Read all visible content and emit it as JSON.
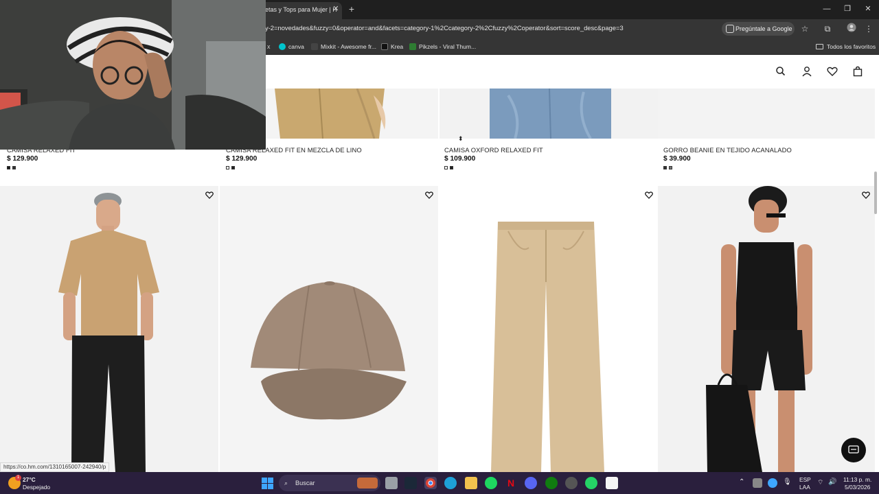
{
  "browser": {
    "tab_title": "etas y Tops para Mujer | H",
    "url": "y-2=novedades&fuzzy=0&operator=and&facets=category-1%2Ccategory-2%2Cfuzzy%2Coperator&sort=score_desc&page=3",
    "ask_google": "Pregúntale a Google",
    "bookmarks": [
      {
        "label": "canva",
        "color": "#00c4cc"
      },
      {
        "label": "Mixkit - Awesome fr...",
        "color": "#444444"
      },
      {
        "label": "Krea",
        "color": "#111111"
      },
      {
        "label": "Pikzels - Viral Thum...",
        "color": "#2e7d32"
      }
    ],
    "bookmark_close": "x",
    "all_favorites": "Todos los favoritos"
  },
  "products_top": [
    {
      "name": "CAMISA RELAXED FIT",
      "price": "$ 129.900",
      "swatches": [
        "#1a1a1a",
        "#333333"
      ]
    },
    {
      "name": "CAMISA RELAXED FIT EN MEZCLA DE LINO",
      "price": "$ 129.900",
      "swatches": [
        "#ffffff",
        "#222222"
      ]
    },
    {
      "name": "CAMISA OXFORD RELAXED FIT",
      "price": "$ 109.900",
      "swatches": [
        "#ffffff",
        "#222222"
      ]
    },
    {
      "name": "GORRO BEANIE EN TEJIDO ACANALADO",
      "price": "$ 39.900",
      "swatches": [
        "#333333",
        "#777777"
      ]
    }
  ],
  "status_bar_url": "https://co.hm.com/1310165007-242940/p",
  "taskbar": {
    "weather_temp": "27°C",
    "weather_desc": "Despejado",
    "weather_badge": "1",
    "search_label": "Buscar",
    "lang_top": "ESP",
    "lang_bottom": "LAA",
    "time": "11:13 p. m.",
    "date": "5/03/2026"
  },
  "colors": {
    "accent": "#000000",
    "taskbar": "#2a1f3d",
    "chrome_dark": "#1f1f1f"
  }
}
